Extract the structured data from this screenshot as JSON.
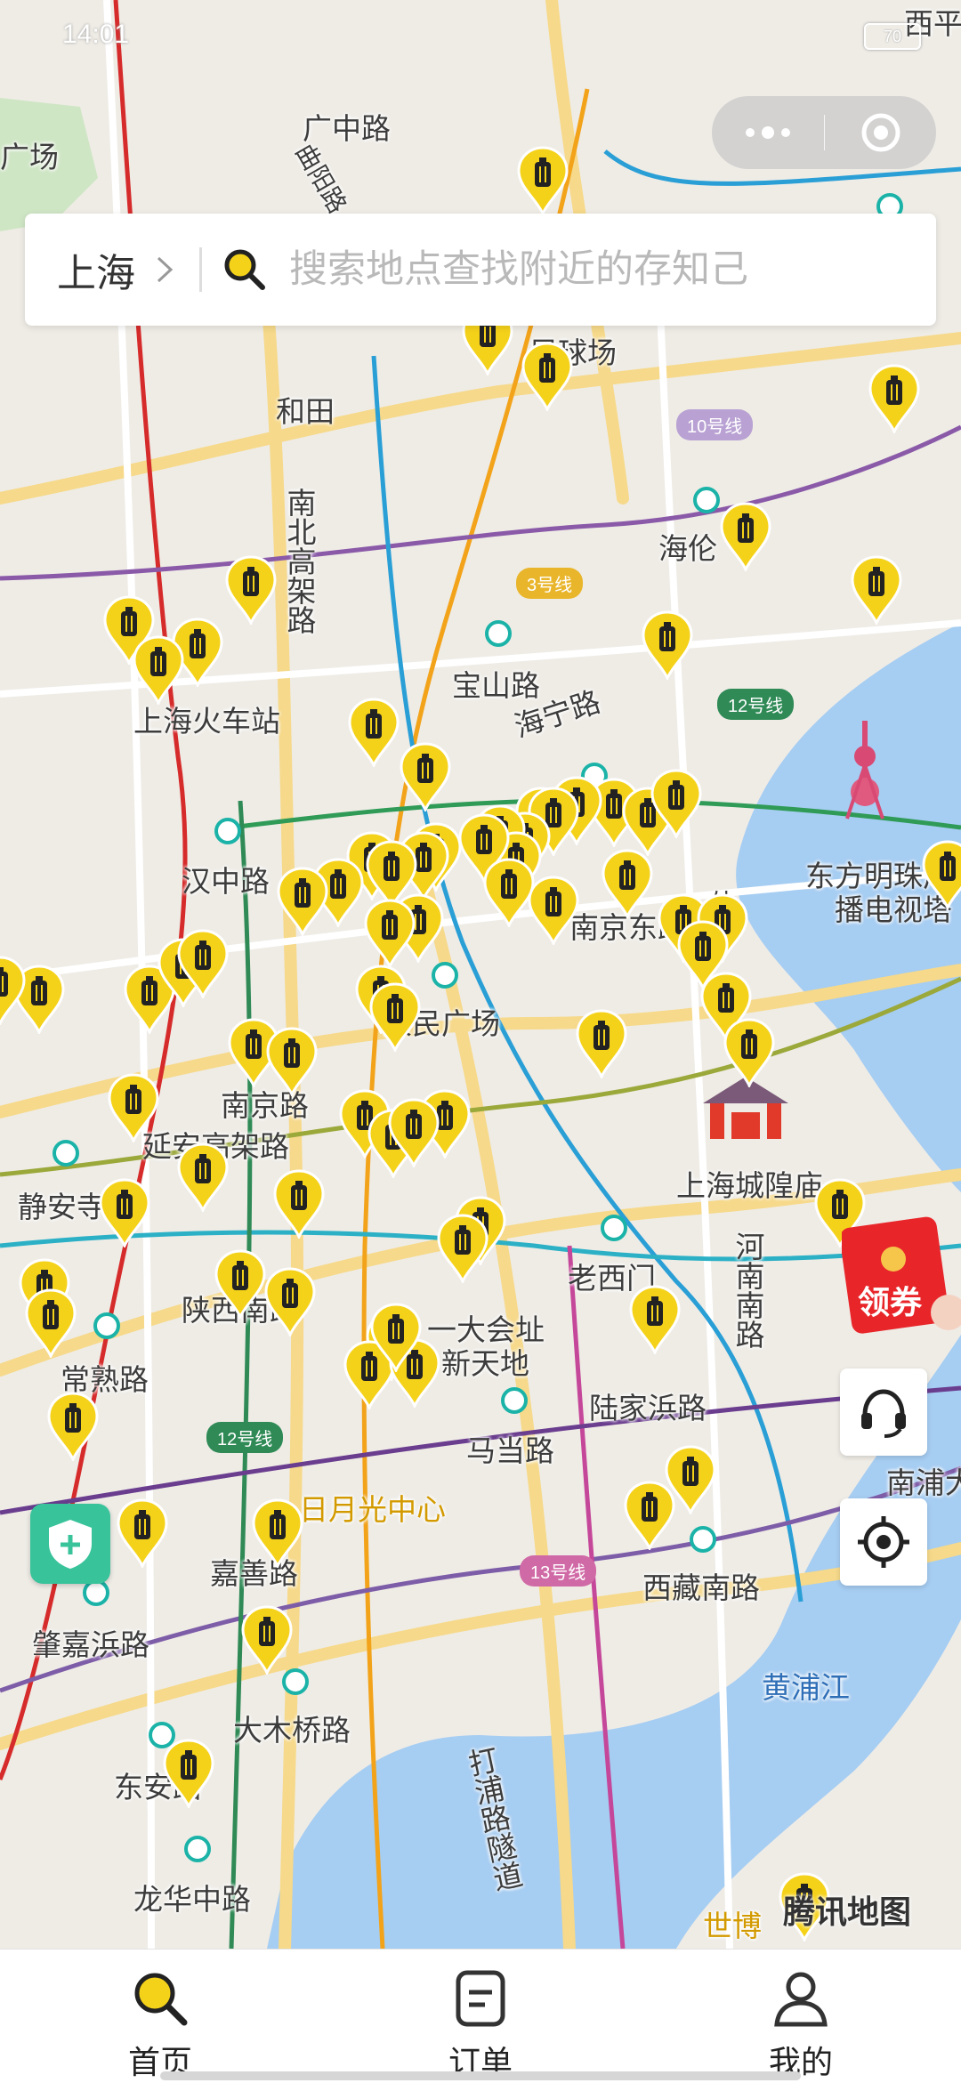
{
  "status_bar": {
    "time": "14:01",
    "battery": "70"
  },
  "search": {
    "city": "上海",
    "placeholder": "搜索地点查找附近的存知己"
  },
  "map": {
    "labels": [
      "广场",
      "广中路",
      "曲阳路",
      "和田",
      "南北高架路",
      "海伦",
      "宝山路",
      "上海火车站",
      "海宁路",
      "汉中路",
      "南京路",
      "延安高架路",
      "静安寺",
      "陕西南路",
      "常熟路",
      "一大会址",
      "新天地",
      "马当路",
      "老西门",
      "陆家浜路",
      "上海城隍庙",
      "河南南路",
      "东方明珠广播电视塔",
      "南浦大桥",
      "日月光中心",
      "嘉善路",
      "西藏南路",
      "肇嘉浜路",
      "黄浦江",
      "大木桥路",
      "东安路",
      "龙华中路",
      "打浦路隧道",
      "世博",
      "人民广场",
      "南京东路",
      "足球场",
      "外滩",
      "西平"
    ],
    "line_badges": [
      "10号线",
      "3号线",
      "12号线",
      "12号线",
      "13号线"
    ],
    "watermark": "腾讯地图"
  },
  "coupon": {
    "label": "领券"
  },
  "tabs": [
    {
      "label": "首页",
      "icon": "search-icon"
    },
    {
      "label": "订单",
      "icon": "order-icon"
    },
    {
      "label": "我的",
      "icon": "user-icon"
    }
  ],
  "colors": {
    "accent": "#f5d21a",
    "brand_dark": "#333333",
    "shield": "#39c39b",
    "coupon": "#e8262a"
  }
}
